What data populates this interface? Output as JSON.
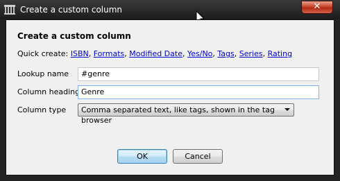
{
  "window": {
    "title": "Create a custom column",
    "close_label": "✕"
  },
  "dialog": {
    "heading": "Create a custom column",
    "quick_create_label": "Quick create:",
    "quick_links": [
      "ISBN",
      "Formats",
      "Modified Date",
      "Yes/No",
      "Tags",
      "Series",
      "Rating"
    ],
    "lookup_name_label": "Lookup name",
    "lookup_name_value": "#genre",
    "column_heading_label": "Column heading",
    "column_heading_value": "Genre",
    "column_type_label": "Column type",
    "column_type_value": "Comma separated text, like tags, shown in the tag browser"
  },
  "buttons": {
    "ok": "OK",
    "cancel": "Cancel"
  },
  "icons": {
    "app": "library-icon",
    "close": "close-icon",
    "dropdown": "chevron-down-icon",
    "cursor": "mouse-pointer-icon"
  }
}
